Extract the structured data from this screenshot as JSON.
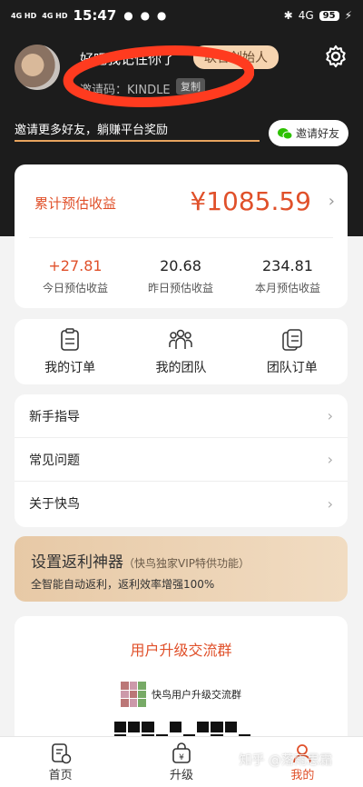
{
  "status_bar": {
    "signal1": "4G HD",
    "signal2": "4G HD",
    "time": "15:47",
    "status_icons": "● ● ●",
    "bluetooth": "✱",
    "signal": "4G",
    "battery": "95",
    "charging": "⚡"
  },
  "profile": {
    "username": "好吧我记住你了",
    "badge": "联合创始人",
    "invite_code": "邀请码：KINDLE",
    "copy_label": "复制",
    "promo": "邀请更多好友，躺赚平台奖励",
    "invite_friends": "邀请好友"
  },
  "earnings": {
    "label": "累计预估收益",
    "total": "¥1085.59",
    "stats": [
      {
        "value": "+27.81",
        "label": "今日预估收益"
      },
      {
        "value": "20.68",
        "label": "昨日预估收益"
      },
      {
        "value": "234.81",
        "label": "本月预估收益"
      }
    ]
  },
  "grid": [
    {
      "label": "我的订单",
      "icon": "clipboard-icon"
    },
    {
      "label": "我的团队",
      "icon": "team-icon"
    },
    {
      "label": "团队订单",
      "icon": "team-orders-icon"
    }
  ],
  "menu": [
    {
      "label": "新手指导"
    },
    {
      "label": "常见问题"
    },
    {
      "label": "关于快鸟"
    }
  ],
  "rebate": {
    "title": "设置返利神器",
    "subtitle": "（快鸟独家VIP特供功能）",
    "desc": "全智能自动返利，返利效率增强100%"
  },
  "group": {
    "title": "用户升级交流群",
    "name": "快鸟用户升级交流群"
  },
  "tabs": [
    {
      "label": "首页"
    },
    {
      "label": "升级"
    },
    {
      "label": "我的"
    }
  ],
  "watermark": "知乎 @落雨思霜",
  "colors": {
    "accent": "#e0502a",
    "header_bg": "#1c1c1c",
    "badge_bg": "#f6d4b0",
    "scribble": "#ff3b1f"
  }
}
